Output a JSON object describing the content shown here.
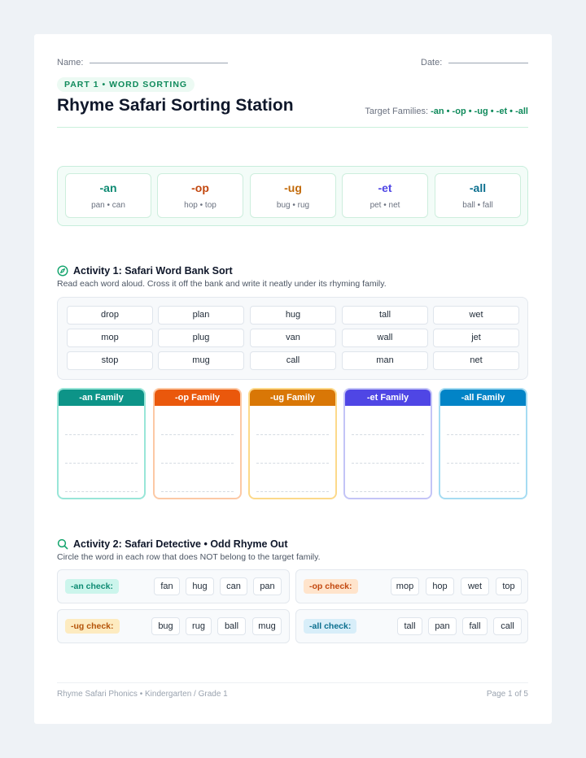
{
  "header": {
    "name_label": "Name:",
    "date_label": "Date:",
    "part_label": "PART 1 • WORD SORTING",
    "title": "Rhyme Safari Sorting Station",
    "target_label": "Target Families:",
    "target_list": "-an • -op • -ug • -et • -all"
  },
  "families": [
    {
      "name": "-an",
      "examples": "pan • can",
      "color": "#0d8a72"
    },
    {
      "name": "-op",
      "examples": "hop • top",
      "color": "#c2470e"
    },
    {
      "name": "-ug",
      "examples": "bug • rug",
      "color": "#c26a0a"
    },
    {
      "name": "-et",
      "examples": "pet • net",
      "color": "#4f46e5"
    },
    {
      "name": "-all",
      "examples": "ball • fall",
      "color": "#0b6f8f"
    }
  ],
  "activity1": {
    "icon": "compass-icon",
    "title": "Activity 1: Safari Word Bank Sort",
    "description": "Read each word aloud. Cross it off the bank and write it neatly under its rhyming family.",
    "word_bank": [
      [
        "drop",
        "plan",
        "hug",
        "tall",
        "wet"
      ],
      [
        "mop",
        "plug",
        "van",
        "wall",
        "jet"
      ],
      [
        "stop",
        "mug",
        "call",
        "man",
        "net"
      ]
    ],
    "columns": [
      {
        "label": "-an Family",
        "color": "#0d9488",
        "border": "#99e6d8"
      },
      {
        "label": "-op Family",
        "color": "#ea580c",
        "border": "#fcc9a5"
      },
      {
        "label": "-ug Family",
        "color": "#d97706",
        "border": "#fcd98a"
      },
      {
        "label": "-et Family",
        "color": "#4f46e5",
        "border": "#c3c4f7"
      },
      {
        "label": "-all Family",
        "color": "#0284c7",
        "border": "#a6dcf2"
      }
    ]
  },
  "activity2": {
    "icon": "magnifier-icon",
    "title": "Activity 2: Safari Detective • Odd Rhyme Out",
    "description": "Circle the word in each row that does NOT belong to the target family.",
    "checks": [
      {
        "label": "-an check:",
        "words": [
          "fan",
          "hug",
          "can",
          "pan"
        ],
        "bg": "#ccf5ec",
        "fg": "#0d8a72"
      },
      {
        "label": "-op check:",
        "words": [
          "mop",
          "hop",
          "wet",
          "top"
        ],
        "bg": "#ffe4cc",
        "fg": "#c2470e"
      },
      {
        "label": "-ug check:",
        "words": [
          "bug",
          "rug",
          "ball",
          "mug"
        ],
        "bg": "#fdebc0",
        "fg": "#b45309"
      },
      {
        "label": "-all check:",
        "words": [
          "tall",
          "pan",
          "fall",
          "call"
        ],
        "bg": "#d8eef9",
        "fg": "#0b6f8f"
      }
    ]
  },
  "footer": {
    "left": "Rhyme Safari Phonics • Kindergarten / Grade 1",
    "right": "Page 1 of 5"
  }
}
